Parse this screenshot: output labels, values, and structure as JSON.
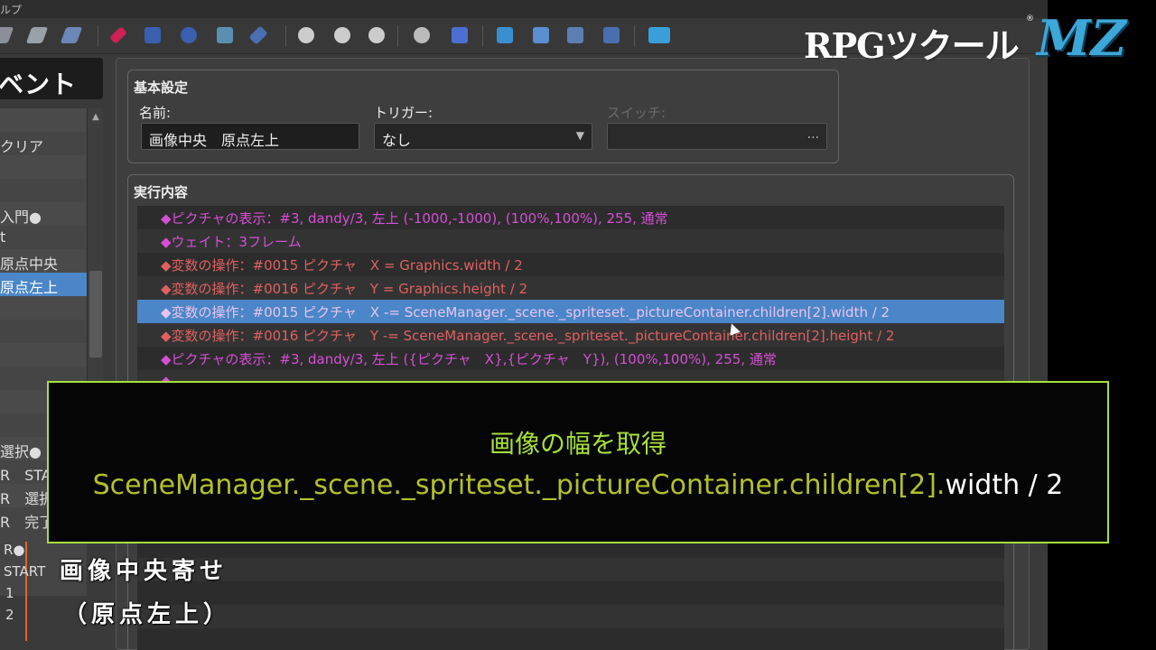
{
  "menubar": {
    "help_label": "ルプ"
  },
  "logo": {
    "text": "RPGツクール",
    "mz": "MZ",
    "registered": "®"
  },
  "left_panel": {
    "header": "ベント",
    "events": [
      {
        "label": ""
      },
      {
        "label": "クリア"
      },
      {
        "label": ""
      },
      {
        "label": ""
      },
      {
        "label": "入門●"
      },
      {
        "label": "t"
      },
      {
        "label": "原点中央"
      },
      {
        "label": "原点左上",
        "selected": true
      },
      {
        "label": ""
      },
      {
        "label": ""
      },
      {
        "label": ""
      },
      {
        "label": ""
      },
      {
        "label": ""
      },
      {
        "label": ""
      },
      {
        "label": "選択●"
      },
      {
        "label": "R　START"
      },
      {
        "label": "R　選択"
      },
      {
        "label": "R　完了"
      }
    ],
    "pages": [
      {
        "label": "R●"
      },
      {
        "label": "START"
      },
      {
        "label": "1"
      },
      {
        "label": "2"
      }
    ]
  },
  "basic": {
    "title": "基本設定",
    "name_label": "名前:",
    "name_value": "画像中央　原点左上",
    "trigger_label": "トリガー:",
    "trigger_value": "なし",
    "switch_label": "スイッチ:",
    "switch_value": "...",
    "trigger_arrow": "▼",
    "scroll_up": "▲"
  },
  "exec": {
    "title": "実行内容",
    "commands": [
      {
        "text": "◆ピクチャの表示：#3, dandy/3, 左上 (-1000,-1000), (100%,100%), 255, 通常",
        "color": "pink"
      },
      {
        "text": "◆ウェイト：3フレーム",
        "color": "pink"
      },
      {
        "text": "◆変数の操作：#0015 ピクチャ　X = Graphics.width / 2",
        "color": "red"
      },
      {
        "text": "◆変数の操作：#0016 ピクチャ　Y = Graphics.height / 2",
        "color": "red"
      },
      {
        "text": "◆変数の操作：#0015 ピクチャ　X -= SceneManager._scene._spriteset._pictureContainer.children[2].width / 2",
        "color": "red",
        "selected": true
      },
      {
        "text": "◆変数の操作：#0016 ピクチャ　Y -= SceneManager._scene._spriteset._pictureContainer.children[2].height / 2",
        "color": "red"
      },
      {
        "text": "◆ピクチャの表示：#3, dandy/3, 左上 ({ピクチャ　X},{ピクチャ　Y}), (100%,100%), 255, 通常",
        "color": "pink"
      },
      {
        "text": "◆",
        "color": "pink"
      }
    ]
  },
  "overlay": {
    "title": "画像の幅を取得",
    "code_highlight": "SceneManager._scene._spriteset._pictureContainer.children[2].",
    "code_plain": "width / 2"
  },
  "caption": {
    "line1": "画像中央寄せ",
    "line2": "（原点左上）"
  },
  "colors": {
    "accent_green": "#a7e03a",
    "selection_blue": "#4a86c8",
    "cmd_pink": "#d54fd5",
    "cmd_red": "#e06060",
    "logo_blue": "#3da7d8"
  }
}
